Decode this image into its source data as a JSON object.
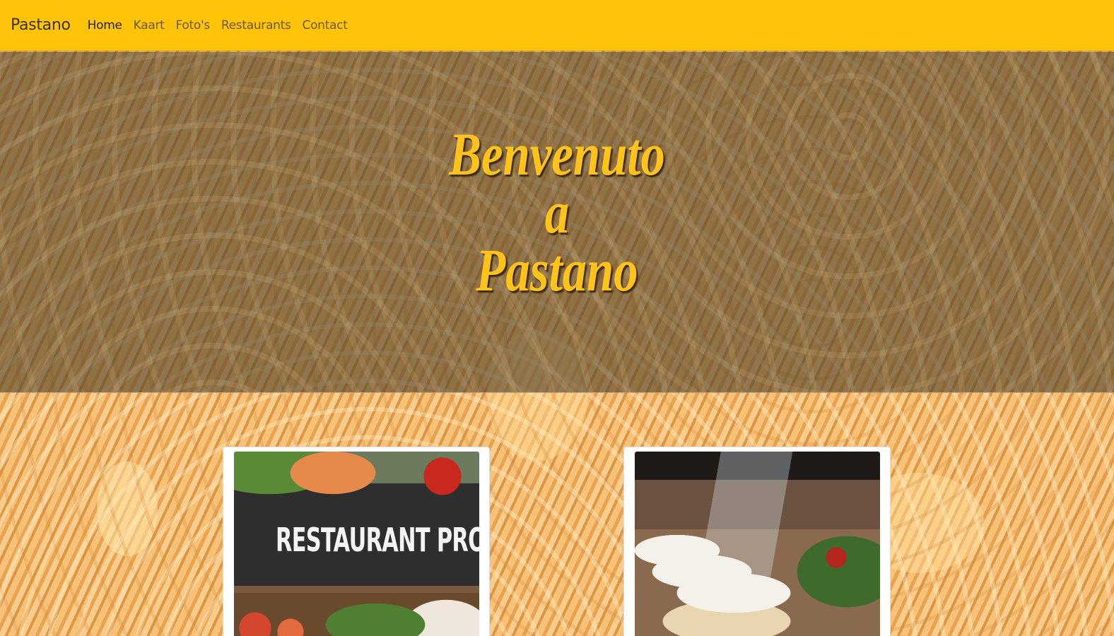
{
  "navbar": {
    "brand": "Pastano",
    "links": [
      {
        "label": "Home",
        "active": true
      },
      {
        "label": "Kaart",
        "active": false
      },
      {
        "label": "Foto's",
        "active": false
      },
      {
        "label": "Restaurants",
        "active": false
      },
      {
        "label": "Contact",
        "active": false
      }
    ],
    "background_color": "#ffc30a"
  },
  "hero": {
    "title": "Benvenuto\na\nPastano",
    "title_color": "#ffc31a"
  },
  "cards": [
    {
      "image": "restaurant-promo-image",
      "image_text": "RESTAURANT PROMO"
    },
    {
      "image": "dinner-table-image"
    }
  ]
}
